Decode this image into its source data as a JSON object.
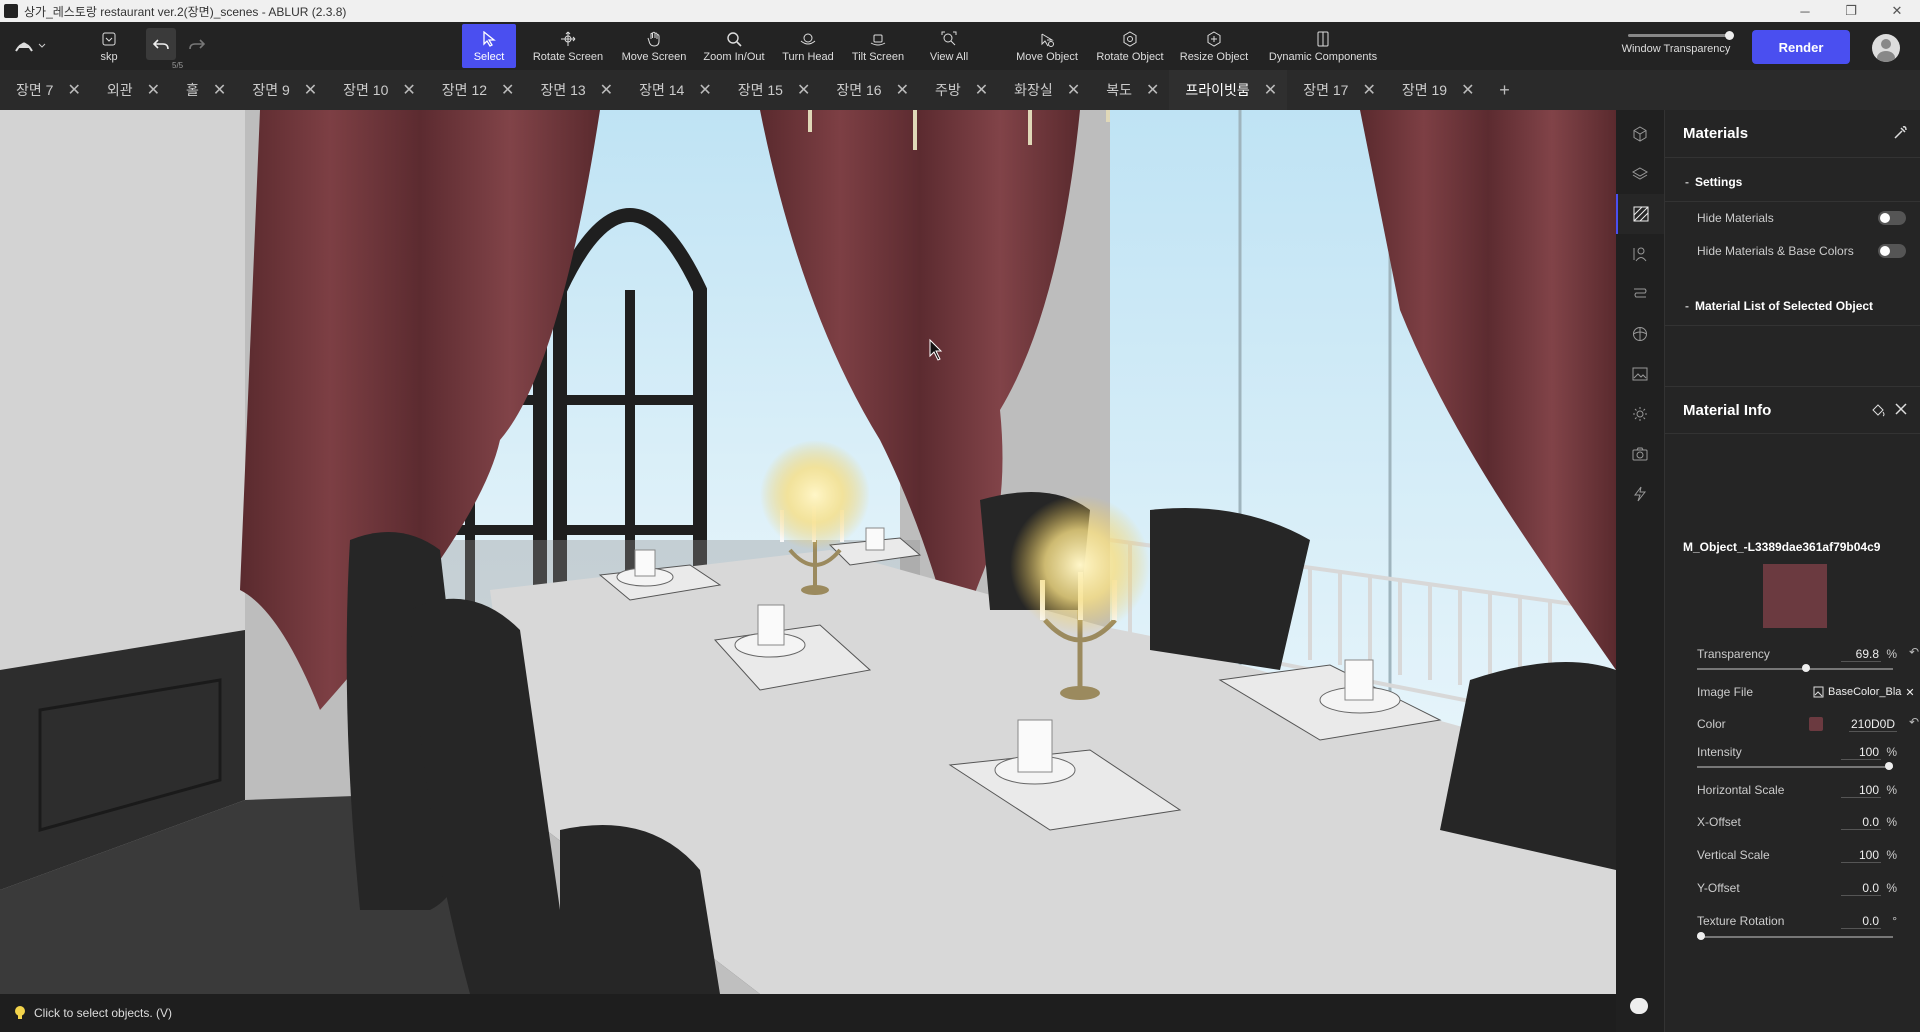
{
  "window": {
    "title": "상가_레스토랑 restaurant ver.2(장면)_scenes - ABLUR (2.3.8)",
    "minimize": "─",
    "maximize": "❐",
    "close": "✕"
  },
  "toolbar": {
    "file_label": "skp",
    "undo_count": "5/5",
    "tools": [
      {
        "label": "Select",
        "icon": "cursor-icon"
      },
      {
        "label": "Rotate Screen",
        "icon": "orbit-icon"
      },
      {
        "label": "Move Screen",
        "icon": "hand-icon"
      },
      {
        "label": "Zoom In/Out",
        "icon": "magnifier-icon"
      },
      {
        "label": "Turn Head",
        "icon": "head-turn-icon"
      },
      {
        "label": "Tilt Screen",
        "icon": "tilt-icon"
      },
      {
        "label": "View All",
        "icon": "view-all-icon"
      },
      {
        "label": "Move Object",
        "icon": "move-object-icon"
      },
      {
        "label": "Rotate Object",
        "icon": "rotate-object-icon"
      },
      {
        "label": "Resize Object",
        "icon": "resize-object-icon"
      },
      {
        "label": "Dynamic Components",
        "icon": "dynamic-components-icon"
      }
    ],
    "active_tool": "Select",
    "window_transparency_label": "Window Transparency",
    "render_label": "Render",
    "accent_color": "#4a4ff0"
  },
  "tabs": [
    {
      "label": "장면 7",
      "active": false
    },
    {
      "label": "외관",
      "active": false
    },
    {
      "label": "홀",
      "active": false
    },
    {
      "label": "장면 9",
      "active": false
    },
    {
      "label": "장면 10",
      "active": false
    },
    {
      "label": "장면 12",
      "active": false
    },
    {
      "label": "장면 13",
      "active": false
    },
    {
      "label": "장면 14",
      "active": false
    },
    {
      "label": "장면 15",
      "active": false
    },
    {
      "label": "장면 16",
      "active": false
    },
    {
      "label": "주방",
      "active": false
    },
    {
      "label": "화장실",
      "active": false
    },
    {
      "label": "복도",
      "active": false
    },
    {
      "label": "프라이빗룸",
      "active": true
    },
    {
      "label": "장면 17",
      "active": false
    },
    {
      "label": "장면 19",
      "active": false
    }
  ],
  "tab_close": "✕",
  "tab_add": "+",
  "status": {
    "hint": "Click to select objects. (V)"
  },
  "panel": {
    "materials_title": "Materials",
    "settings_section": "Settings",
    "hide_materials_label": "Hide Materials",
    "hide_materials_on": false,
    "hide_base_colors_label": "Hide Materials & Base Colors",
    "hide_base_colors_on": false,
    "material_list_section": "Material List of Selected Object",
    "material_info_title": "Material Info",
    "material_name": "M_Object_-L3389dae361af79b04c9",
    "swatch_color": "#6b3a40",
    "transparency_label": "Transparency",
    "transparency_value": "69.8",
    "transparency_fraction": 0.56,
    "percent_unit": "%",
    "image_file_label": "Image File",
    "image_file_value": "BaseColor_Bla",
    "color_label": "Color",
    "color_value": "210D0D",
    "intensity_label": "Intensity",
    "intensity_value": "100",
    "intensity_fraction": 1.0,
    "horizontal_scale_label": "Horizontal Scale",
    "horizontal_scale_value": "100",
    "x_offset_label": "X-Offset",
    "x_offset_value": "0.0",
    "vertical_scale_label": "Vertical Scale",
    "vertical_scale_value": "100",
    "y_offset_label": "Y-Offset",
    "y_offset_value": "0.0",
    "texture_rotation_label": "Texture Rotation",
    "texture_rotation_value": "0.0",
    "degree_unit": "°",
    "texture_rotation_fraction": 0.0
  }
}
